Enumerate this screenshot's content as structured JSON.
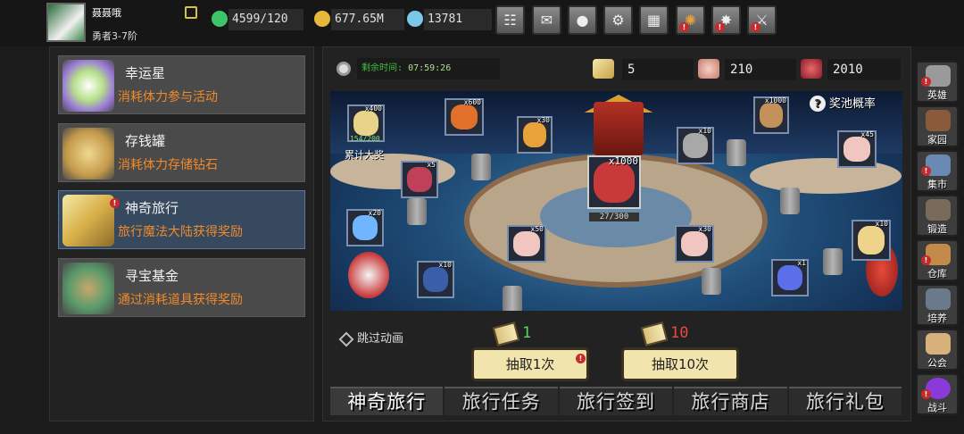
{
  "player": {
    "name": "聂聂哦",
    "rank": "勇者3-7阶"
  },
  "resources": {
    "stamina": "4599/120",
    "gold": "677.65M",
    "diamond": "13781"
  },
  "top_buttons": [
    {
      "name": "shop",
      "icon": "cart-icon"
    },
    {
      "name": "mail",
      "icon": "mail-icon"
    },
    {
      "name": "gamepad",
      "icon": "gamepad-icon"
    },
    {
      "name": "settings",
      "icon": "gear-icon"
    },
    {
      "name": "gift",
      "icon": "gift-icon"
    },
    {
      "name": "wheel",
      "icon": "wheel-icon"
    },
    {
      "name": "fireworks",
      "icon": "fireworks-icon"
    },
    {
      "name": "battle",
      "icon": "crossed-swords-icon"
    }
  ],
  "activities": [
    {
      "title": "幸运星",
      "desc": "消耗体力参与活动",
      "color": "#8fd47a"
    },
    {
      "title": "存钱罐",
      "desc": "消耗体力存储钻石",
      "color": "#d8b06a"
    },
    {
      "title": "神奇旅行",
      "desc": "旅行魔法大陆获得奖励",
      "color": "#e6c35a",
      "active": true
    },
    {
      "title": "寻宝基金",
      "desc": "通过消耗道具获得奖励",
      "color": "#7ab87a"
    }
  ],
  "event": {
    "timer_label": "剩余时间:",
    "timer_value": "07:59:26",
    "tickets": "5",
    "small_bags": "210",
    "red_bags": "2010",
    "rate_label": "奖池概率",
    "accumulate_label": "累计大奖",
    "accumulate_progress": "154/200",
    "grand_progress": "27/300"
  },
  "board_items": [
    {
      "qty": "x400",
      "color": "#e8d38a"
    },
    {
      "qty": "x600",
      "color": "#e0702a"
    },
    {
      "qty": "x30",
      "color": "#e8a23a"
    },
    {
      "qty": "x1000",
      "color": "#c4915a"
    },
    {
      "qty": "x45",
      "color": "#f2c6c0"
    },
    {
      "qty": "x5",
      "color": "#c0405a"
    },
    {
      "qty": "x10",
      "color": "#a8a8a8"
    },
    {
      "qty": "x1000",
      "color": "#c83a3a"
    },
    {
      "qty": "x20",
      "color": "#6fb5ff"
    },
    {
      "qty": "x50",
      "color": "#f2c6c0"
    },
    {
      "qty": "x30",
      "color": "#f2c6c0"
    },
    {
      "qty": "x10",
      "color": "#f0d38a"
    },
    {
      "qty": "x10",
      "color": "#3a5fa8"
    },
    {
      "qty": "x1",
      "color": "#5a6fe8"
    }
  ],
  "draw": {
    "skip_label": "跳过动画",
    "cost_one": "1",
    "cost_ten": "10",
    "draw_one_label": "抽取1次",
    "draw_ten_label": "抽取10次"
  },
  "tabs": [
    "神奇旅行",
    "旅行任务",
    "旅行签到",
    "旅行商店",
    "旅行礼包"
  ],
  "right_nav": [
    {
      "label": "英雄",
      "color": "#9a9a9a"
    },
    {
      "label": "家园",
      "color": "#8a5a3a"
    },
    {
      "label": "集市",
      "color": "#6a8ab5"
    },
    {
      "label": "锻造",
      "color": "#7a6a5a"
    },
    {
      "label": "仓库",
      "color": "#c48a4a"
    },
    {
      "label": "培养",
      "color": "#6a7a8a"
    },
    {
      "label": "公会",
      "color": "#d8b07a"
    },
    {
      "label": "战斗",
      "color": "#8a3ad8"
    }
  ]
}
